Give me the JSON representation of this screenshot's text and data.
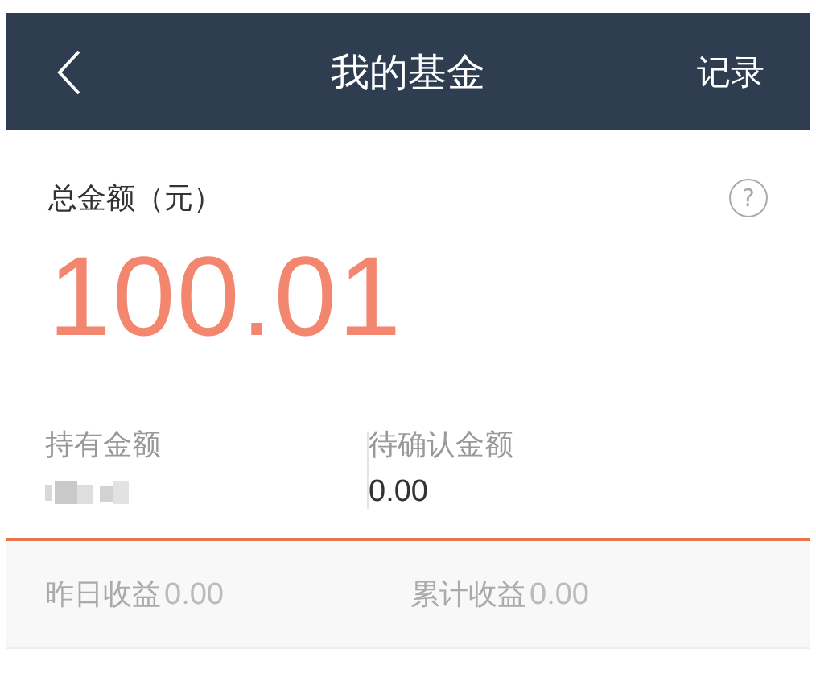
{
  "header": {
    "title": "我的基金",
    "action": "记录"
  },
  "total": {
    "label": "总金额（元）",
    "help": "?",
    "amount": "100.01"
  },
  "holdings": [
    {
      "label": "持有金额",
      "blurred": true
    },
    {
      "label": "待确认金额",
      "blurred": false,
      "value": "0.00"
    }
  ],
  "earnings": [
    {
      "label": "昨日收益",
      "value": "0.00"
    },
    {
      "label": "累计收益",
      "value": "0.00"
    }
  ]
}
